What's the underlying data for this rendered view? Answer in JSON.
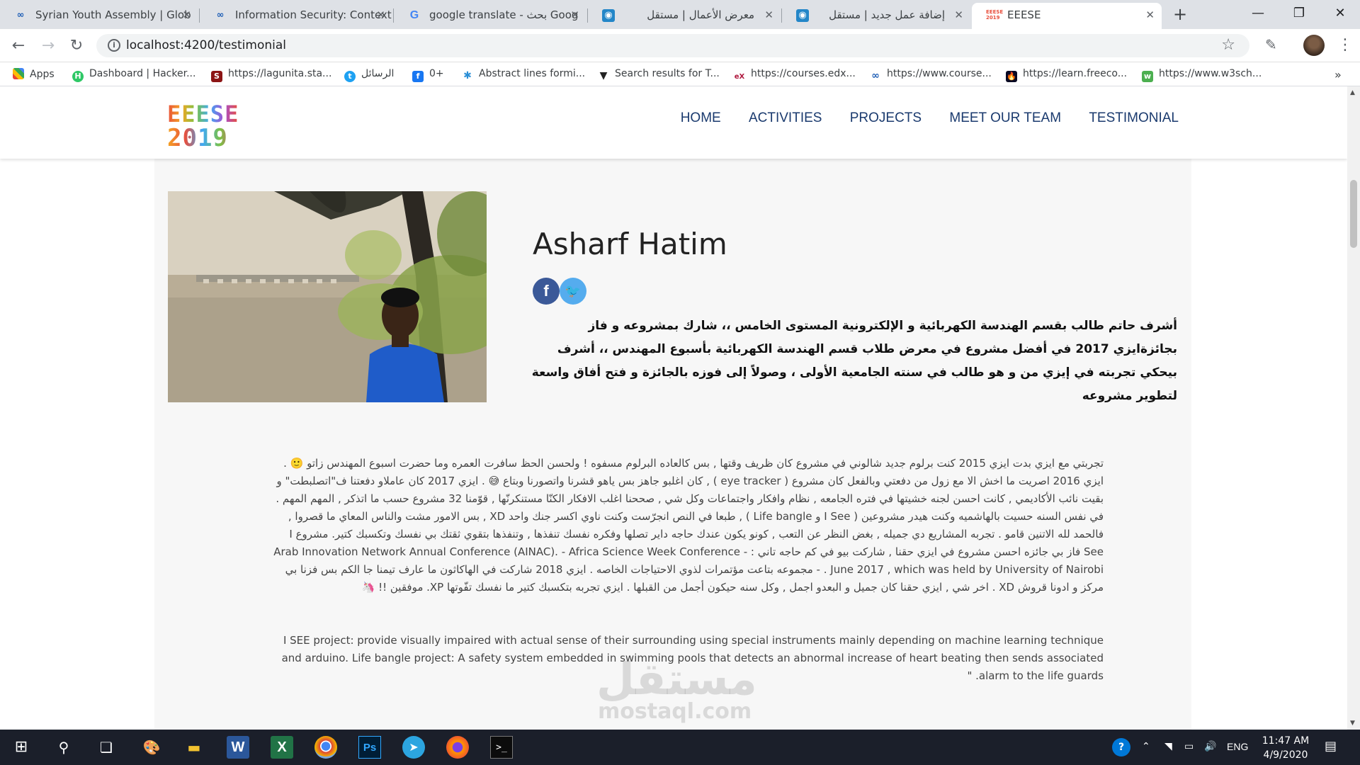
{
  "browser": {
    "tabs": [
      {
        "title": "Syrian Youth Assembly | Glob",
        "icon": "coursera-icon"
      },
      {
        "title": "Information Security: Context",
        "icon": "coursera-icon"
      },
      {
        "title": "google translate - بحث Goog",
        "icon": "google-icon"
      },
      {
        "title": "معرض الأعمال | مستقل",
        "icon": "mostaql-icon"
      },
      {
        "title": "إضافة عمل جديد | مستقل",
        "icon": "mostaql-icon"
      },
      {
        "title": "EEESE",
        "icon": "eeese-icon"
      }
    ],
    "url": "localhost:4200/testimonial",
    "bookmarks": [
      {
        "label": "Apps",
        "icon": "apps-grid-icon"
      },
      {
        "label": "Dashboard | Hacker...",
        "icon": "hackerrank-icon"
      },
      {
        "label": "https://lagunita.sta...",
        "icon": "stanford-icon"
      },
      {
        "label": "الرسائل",
        "icon": "twitter-icon"
      },
      {
        "label": "0+",
        "icon": "facebook-icon"
      },
      {
        "label": "Abstract lines formi...",
        "icon": "spider-icon"
      },
      {
        "label": "Search results for T...",
        "icon": "vectorstock-icon"
      },
      {
        "label": "https://courses.edx...",
        "icon": "edx-icon"
      },
      {
        "label": "https://www.course...",
        "icon": "coursera-icon"
      },
      {
        "label": "https://learn.freeco...",
        "icon": "freecodecamp-icon"
      },
      {
        "label": "https://www.w3sch...",
        "icon": "w3schools-icon"
      }
    ]
  },
  "site": {
    "logo": {
      "line1": "EEESE",
      "line2": "2019"
    },
    "nav": [
      "HOME",
      "ACTIVITIES",
      "PROJECTS",
      "MEET OUR TEAM",
      "TESTIMONIAL"
    ]
  },
  "testimonial": {
    "name": "Asharf Hatim",
    "bio_ar": "أشرف حاتم طالب بقسم الهندسة الكهربائية و الإلكترونية المستوى الخامس ،، شارك بمشروعه و فاز بجائزةايزي 2017 في أفضل مشروع في معرض طلاب قسم الهندسة الكهربائية بأسبوع المهندس ،، أشرف بيحكي تجربته في إيزي من و هو طالب في سنته الجامعية الأولى ، وصولاً إلى فوزه بالجائزة و فتح أفاق واسعة لتطوير مشروعه",
    "story_ar": "تجربتي مع ايزي بدت ايزي 2015 كنت برلوم جديد شالوني في مشروع كان ظريف وقتها , بس كالعاده البرلوم مسفوه ! ولحسن الحظ سافرت العمره وما حضرت اسبوع المهندس زاتو 🙂 . ايزي 2016 اصريت ما اخش الا مع زول من دفعتي وبالفعل كان مشروع ( eye tracker ) , كان اغلبو جاهز بس ياهو قشرنا واتصورنا وبتاع 😅 . ايزي 2017 كان عاملاو دفعتنا ف\"اتصلبطت\" و بقيت نائب الأكاديمي , كانت احسن لجنه خشيتها في فتره الجامعه , نظام وافكار واجتماعات وكل شي , صححنا اغلب الافكار الكنّا مستنكرنّها , قوّمنا 32 مشروع حسب ما اتذكر , المهم المهم . في نفس السنه حسيت بالهاشميه وكنت هيدر مشروعين ( I See و Life bangle ) , طبعا في النص انجرّست وكنت ناوي اكسر جنك واحد XD , بس الامور مشت والناس المعاي ما قصروا , فالحمد لله الاتنين قامو . تجربه المشاريع دي جميله , بغض النظر عن التعب , كونو يكون عندك حاجه داير تصلها وفكره نفسك تنفذها , وتنفذها بتقوي ثقتك بي نفسك وتكسبك كتير. مشروع I See فاز بي جائزه احسن مشروع في ايزي حقنا , شاركت بيو في كم حاجه تاني : - Arab Innovation Network Annual Conference (AINAC). - Africa Science Week Conference June 2017 , which was held by University of Nairobi . - مجموعه بتاعت مؤتمرات لذوي الاحتياجات الخاصه . ايزي 2018 شاركت في الهاكاثون ما عارف تيمنا جا الكم بس فزنا بي مركز و ادونا قروش XD . اخر شي , ايزي حقنا كان جميل و البعدو اجمل , وكل سنه حيكون أجمل من القبلها . ايزي تجربه بتكسبك كتير ما نفسك تفّوتها XP. موفقين !! 🦄",
    "story_en": "I SEE project: provide visually impaired with actual sense of their surrounding using special instruments mainly depending on machine learning technique and arduino. Life bangle project: A safety system embedded in swimming pools that detects an abnormal increase of heart beating then sends associated alarm to the life guards. \""
  },
  "watermark": {
    "line1": "مستقل",
    "line2": "mostaql.com"
  },
  "taskbar": {
    "apps": [
      "windows-start-icon",
      "search-icon",
      "task-view-icon",
      "paint-icon",
      "file-explorer-icon",
      "word-icon",
      "excel-icon",
      "chrome-icon",
      "photoshop-icon",
      "telegram-icon",
      "firefox-icon",
      "terminal-icon"
    ],
    "lang": "ENG",
    "time": "11:47 AM",
    "date": "4/9/2020"
  }
}
